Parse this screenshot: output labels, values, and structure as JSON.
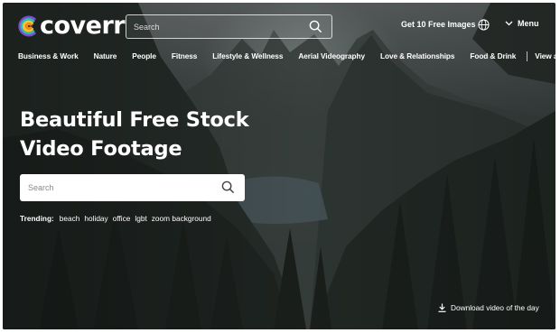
{
  "header": {
    "logo_text": "coverr",
    "search_placeholder": "Search",
    "get_free_images": "Get 10 Free Images",
    "menu_label": "Menu"
  },
  "categories": [
    "Business & Work",
    "Nature",
    "People",
    "Fitness",
    "Lifestyle & Wellness",
    "Aerial Videography",
    "Love & Relationships",
    "Food & Drink"
  ],
  "view_all": "View all",
  "hero": {
    "title_line1": "Beautiful Free Stock",
    "title_line2": "Video Footage",
    "search_placeholder": "Search"
  },
  "trending": {
    "label": "Trending:",
    "tags": [
      "beach",
      "holiday",
      "office",
      "lgbt",
      "zoom background"
    ]
  },
  "download_label": "Download video of the day",
  "icons": {
    "logo_mark": "rainbow-c-icon",
    "search": "search-icon",
    "globe": "globe-icon",
    "menu_chevron": "chevron-down-icon",
    "download": "download-icon"
  },
  "colors": {
    "logo_orange": "#f08a24",
    "logo_yellow": "#f6c628",
    "logo_teal": "#39b8b0",
    "logo_purple": "#7a4fd1",
    "text_white": "#ffffff"
  }
}
